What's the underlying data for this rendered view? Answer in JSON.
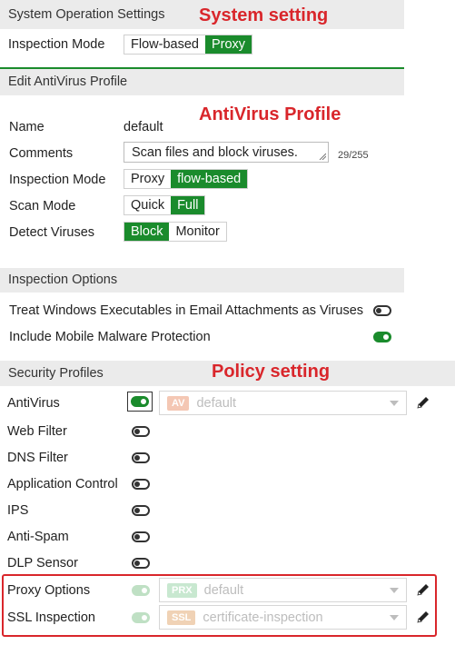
{
  "annotations": {
    "system": "System setting",
    "antivirus": "AntiVirus Profile",
    "policy": "Policy setting"
  },
  "system_settings": {
    "header": "System Operation Settings",
    "inspection_mode_label": "Inspection Mode",
    "options": [
      "Flow-based",
      "Proxy"
    ],
    "selected": "Proxy"
  },
  "av_profile": {
    "header": "Edit AntiVirus Profile",
    "name_label": "Name",
    "name_value": "default",
    "comments_label": "Comments",
    "comments_value": "Scan files and block viruses.",
    "comments_counter": "29/255",
    "inspection_mode_label": "Inspection Mode",
    "inspection_options": [
      "Proxy",
      "flow-based"
    ],
    "scan_mode_label": "Scan Mode",
    "scan_options": [
      "Quick",
      "Full"
    ],
    "detect_label": "Detect Viruses",
    "detect_options": [
      "Block",
      "Monitor"
    ]
  },
  "inspection_options": {
    "header": "Inspection Options",
    "treat_windows_label": "Treat Windows Executables in Email Attachments as Viruses",
    "treat_windows_on": false,
    "mobile_malware_label": "Include Mobile Malware Protection",
    "mobile_malware_on": true
  },
  "security_profiles": {
    "header": "Security Profiles",
    "antivirus_label": "AntiVirus",
    "antivirus_badge": "AV",
    "antivirus_value": "default",
    "web_filter_label": "Web Filter",
    "dns_filter_label": "DNS Filter",
    "app_control_label": "Application Control",
    "ips_label": "IPS",
    "anti_spam_label": "Anti-Spam",
    "dlp_label": "DLP Sensor",
    "proxy_options_label": "Proxy Options",
    "proxy_badge": "PRX",
    "proxy_value": "default",
    "ssl_label": "SSL Inspection",
    "ssl_badge": "SSL",
    "ssl_value": "certificate-inspection"
  },
  "colors": {
    "accent_green": "#1a8b2c",
    "annotation_red": "#d9262b",
    "av_badge": "#f4c7b4",
    "prx_badge": "#c8e8d0",
    "ssl_badge": "#f0d2b5"
  }
}
